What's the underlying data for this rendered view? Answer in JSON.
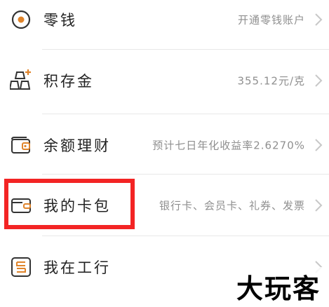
{
  "colors": {
    "icon_accent": "#e0842a",
    "icon_dark": "#333333",
    "title_text": "#222222",
    "desc_text": "#8f8f8f",
    "highlight_border": "#f32424",
    "divider": "#e8e8e8"
  },
  "rows": [
    {
      "icon": "coin-icon",
      "title": "零钱",
      "desc": "开通零钱账户"
    },
    {
      "icon": "gold-bars-icon",
      "title": "积存金",
      "desc": "355.12元/克"
    },
    {
      "icon": "wallet-icon",
      "title": "余额理财",
      "desc": "预计七日年化收益率2.6270%"
    },
    {
      "icon": "card-wallet-icon",
      "title": "我的卡包",
      "desc": "银行卡、会员卡、礼券、发票"
    },
    {
      "icon": "icbc-icon",
      "title": "我在工行",
      "desc": ""
    }
  ],
  "watermark": "大玩客"
}
